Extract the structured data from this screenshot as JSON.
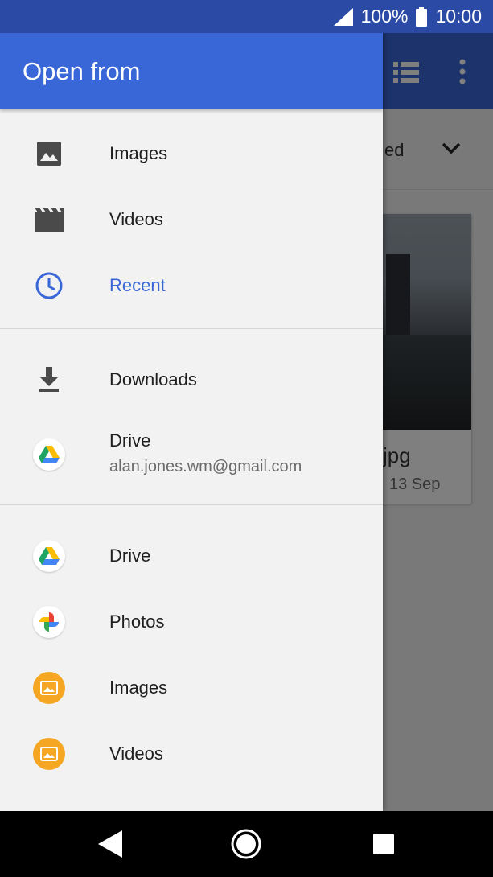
{
  "status_bar": {
    "battery": "100%",
    "time": "10:00"
  },
  "background": {
    "sort_label": "ed",
    "file_name": "jpg",
    "file_date": "13 Sep"
  },
  "drawer": {
    "title": "Open from",
    "section1": [
      {
        "label": "Images",
        "icon": "image-icon"
      },
      {
        "label": "Videos",
        "icon": "video-icon"
      },
      {
        "label": "Recent",
        "icon": "clock-icon",
        "active": true
      }
    ],
    "section2": [
      {
        "label": "Downloads",
        "icon": "download-icon"
      },
      {
        "label": "Drive",
        "sub": "alan.jones.wm@gmail.com",
        "icon": "google-drive-icon"
      }
    ],
    "section3": [
      {
        "label": "Drive",
        "icon": "google-drive-icon"
      },
      {
        "label": "Photos",
        "icon": "google-photos-icon"
      },
      {
        "label": "Images",
        "icon": "gallery-images-icon"
      },
      {
        "label": "Videos",
        "icon": "gallery-videos-icon"
      }
    ]
  },
  "colors": {
    "accent": "#3a67d8",
    "status_bar": "#2b4aa6",
    "orange": "#f5a623"
  }
}
